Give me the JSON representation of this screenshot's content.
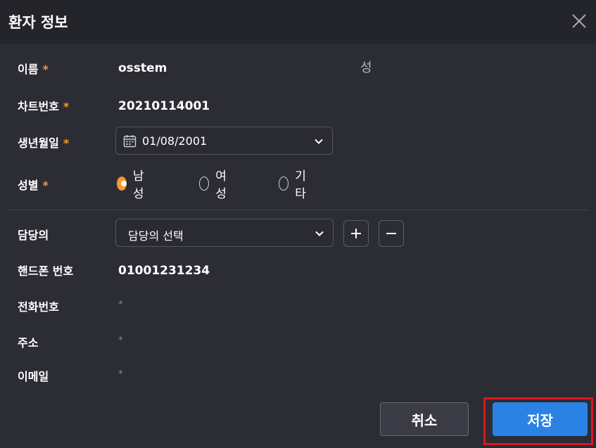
{
  "dialog": {
    "title": "환자 정보"
  },
  "required_mark": "*",
  "fields": {
    "name": {
      "label": "이름",
      "value": "osstem",
      "surname_placeholder": "성"
    },
    "chart_number": {
      "label": "차트번호",
      "value": "20210114001"
    },
    "birthdate": {
      "label": "생년월일",
      "value": "01/08/2001"
    },
    "gender": {
      "label": "성별",
      "options": [
        {
          "label": "남성",
          "selected": true
        },
        {
          "label": "여성",
          "selected": false
        },
        {
          "label": "기타",
          "selected": false
        }
      ]
    },
    "doctor": {
      "label": "담당의",
      "placeholder": "담당의 선택"
    },
    "mobile": {
      "label": "핸드폰 번호",
      "value": "01001231234"
    },
    "phone": {
      "label": "전화번호",
      "value": "*"
    },
    "address": {
      "label": "주소",
      "value": "*"
    },
    "email": {
      "label": "이메일",
      "value": "*"
    }
  },
  "buttons": {
    "cancel": "취소",
    "save": "저장"
  },
  "colors": {
    "background": "#2c2c35",
    "header": "#24242b",
    "accent_orange": "#f29a2e",
    "primary_blue": "#2a82e4",
    "highlight_red": "#e0161d"
  }
}
